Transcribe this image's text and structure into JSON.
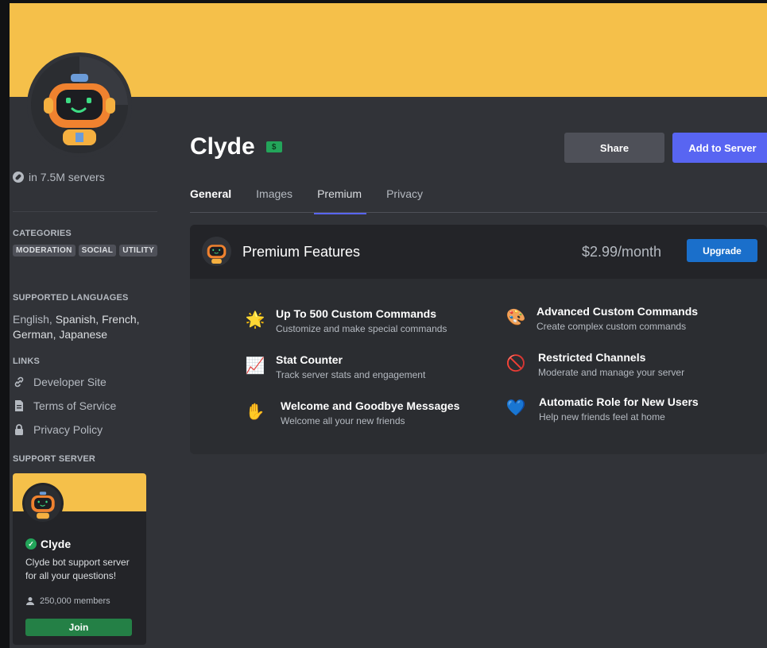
{
  "bot": {
    "name": "Clyde",
    "server_count": "in 7.5M servers"
  },
  "header": {
    "share_label": "Share",
    "add_label": "Add to Server"
  },
  "tabs": [
    {
      "label": "General"
    },
    {
      "label": "Images"
    },
    {
      "label": "Premium"
    },
    {
      "label": "Privacy"
    }
  ],
  "sidebar": {
    "categories_title": "CATEGORIES",
    "categories": [
      "MODERATION",
      "SOCIAL",
      "UTILITY"
    ],
    "languages_title": "SUPPORTED LANGUAGES",
    "languages_lead": "English,",
    "languages_rest": "Spanish, French, German, Japanese",
    "links_title": "LINKS",
    "links": [
      {
        "label": "Developer Site",
        "icon": "link-icon"
      },
      {
        "label": "Terms of Service",
        "icon": "document-icon"
      },
      {
        "label": "Privacy Policy",
        "icon": "lock-icon"
      }
    ],
    "support_title": "SUPPORT SERVER",
    "support": {
      "name": "Clyde",
      "description": "Clyde bot support server for all your questions!",
      "members": "250,000 members",
      "join_label": "Join"
    }
  },
  "premium": {
    "title": "Premium Features",
    "price": "$2.99/month",
    "upgrade_label": "Upgrade",
    "features": [
      {
        "icon": "star-icon",
        "glyph": "🌟",
        "title": "Up To 500 Custom Commands",
        "desc": "Customize and make special commands"
      },
      {
        "icon": "chart-icon",
        "glyph": "📈",
        "title": "Stat Counter",
        "desc": "Track server stats and engagement"
      },
      {
        "icon": "wave-icon",
        "glyph": "✋",
        "title": "Welcome and Goodbye Messages",
        "desc": "Welcome all your new friends"
      },
      {
        "icon": "palette-icon",
        "glyph": "🎨",
        "title": "Advanced Custom Commands",
        "desc": "Create complex custom commands"
      },
      {
        "icon": "prohibited-icon",
        "glyph": "🚫",
        "title": "Restricted Channels",
        "desc": "Moderate and manage your server"
      },
      {
        "icon": "blue-heart-icon",
        "glyph": "💙",
        "title": "Automatic Role for New Users",
        "desc": "Help new friends feel at home"
      }
    ]
  },
  "colors": {
    "banner": "#f5c04a",
    "accent": "#5865f2",
    "upgrade": "#1a6fcb",
    "join": "#248046",
    "verified": "#23a55a"
  }
}
